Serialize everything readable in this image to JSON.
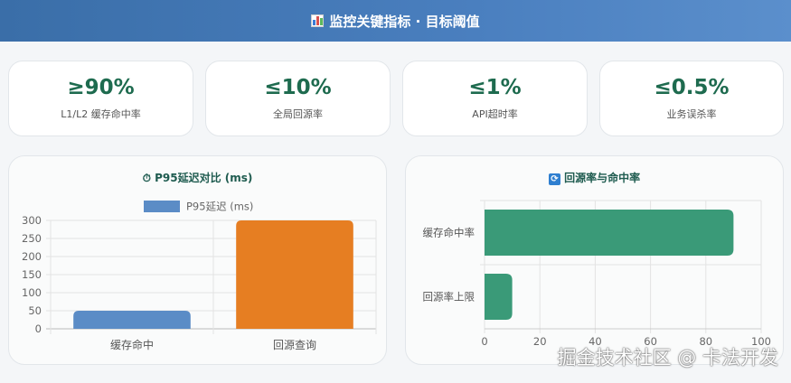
{
  "header": {
    "title": "监控关键指标 · 目标阈值",
    "icon": "bar-chart-icon"
  },
  "kpis": [
    {
      "value": "≥90%",
      "label": "L1/L2 缓存命中率"
    },
    {
      "value": "≤10%",
      "label": "全局回源率"
    },
    {
      "value": "≤1%",
      "label": "API超时率"
    },
    {
      "value": "≤0.5%",
      "label": "业务误杀率"
    }
  ],
  "left_panel": {
    "title": "P95延迟对比 (ms)",
    "icon": "stopwatch-icon"
  },
  "right_panel": {
    "title": "回源率与命中率",
    "icon": "refresh-icon"
  },
  "watermark": "掘金技术社区 @ 卡法开发",
  "chart_data": [
    {
      "type": "bar",
      "title": "P95延迟对比 (ms)",
      "categories": [
        "缓存命中",
        "回源查询"
      ],
      "series": [
        {
          "name": "P95延迟 (ms)",
          "values": [
            50,
            300
          ]
        }
      ],
      "colors": [
        "#5b8cc6",
        "#e67e22"
      ],
      "yticks": [
        0,
        50,
        100,
        150,
        200,
        250,
        300
      ],
      "ylim": [
        0,
        300
      ],
      "legend": "top",
      "grid": true
    },
    {
      "type": "bar",
      "orientation": "horizontal",
      "title": "回源率与命中率",
      "categories": [
        "缓存命中率",
        "回源率上限"
      ],
      "values": [
        90,
        10
      ],
      "color": "#3a9a78",
      "xticks": [
        0,
        20,
        40,
        60,
        80,
        100
      ],
      "xlim": [
        0,
        100
      ],
      "grid": true
    }
  ]
}
